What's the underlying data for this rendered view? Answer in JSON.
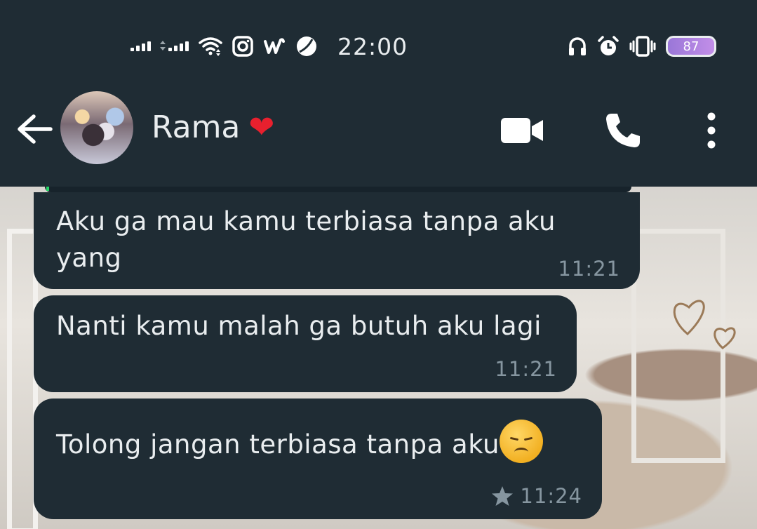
{
  "status_bar": {
    "time": "22:00",
    "battery": "87",
    "icons": [
      "signal-1-icon",
      "signal-2-icon",
      "wifi-icon",
      "instagram-icon",
      "wattpad-icon",
      "leaf-icon",
      "headphones-icon",
      "alarm-icon",
      "vibrate-icon",
      "battery-icon"
    ]
  },
  "header": {
    "contact_name": "Rama",
    "heart": "❤",
    "icons": [
      "back-arrow-icon",
      "video-call-icon",
      "phone-call-icon",
      "more-options-icon"
    ]
  },
  "messages": [
    {
      "text_line1": "Aku ga mau kamu terbiasa tanpa aku",
      "text_line2": "yang",
      "time": "11:21"
    },
    {
      "text": "Nanti kamu malah ga butuh aku lagi",
      "time": "11:21"
    },
    {
      "text": "Tolong jangan terbiasa tanpa aku",
      "emoji": "disappointed-face-emoji",
      "time": "11:24",
      "starred": true
    }
  ],
  "colors": {
    "bar_bg": "#1f2c34",
    "bubble_bg": "#1f2c34",
    "text": "#e9edef",
    "timestamp": "#8696a0",
    "battery": "#b085e0",
    "heart": "#e8202e"
  }
}
